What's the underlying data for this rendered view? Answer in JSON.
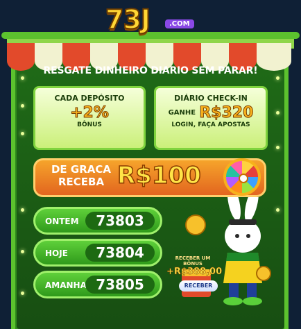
{
  "logo": {
    "number": "73J",
    "domain": ".COM"
  },
  "headline": "RESGATE DINHEIRO DIARIO SEM PARAR!",
  "deposit_card": {
    "title": "CADA DEPÓSITO",
    "value": "+2%",
    "subtitle": "BÔNUS"
  },
  "checkin_card": {
    "title": "DIÁRIO CHECK-IN",
    "prefix": "GANHE",
    "value": "R$320",
    "subtitle": "LOGIN, FAÇA APOSTAS"
  },
  "promo": {
    "line1": "DE GRACA",
    "line2": "RECEBA",
    "amount": "R$100"
  },
  "stats": [
    {
      "label": "ONTEM",
      "value": "73803"
    },
    {
      "label": "HOJE",
      "value": "73804"
    },
    {
      "label": "AMANHA",
      "value": "73805"
    }
  ],
  "bonus": {
    "label": "RECEBER UM BÔNUS",
    "amount": "+R$388,00",
    "button": "RECEBER"
  },
  "colors": {
    "booth_green": "#2f8a1c",
    "card_bg": "#e8fbb5",
    "gold": "#ffe447",
    "promo_orange": "#f08a25",
    "bg": "#0f2036"
  }
}
